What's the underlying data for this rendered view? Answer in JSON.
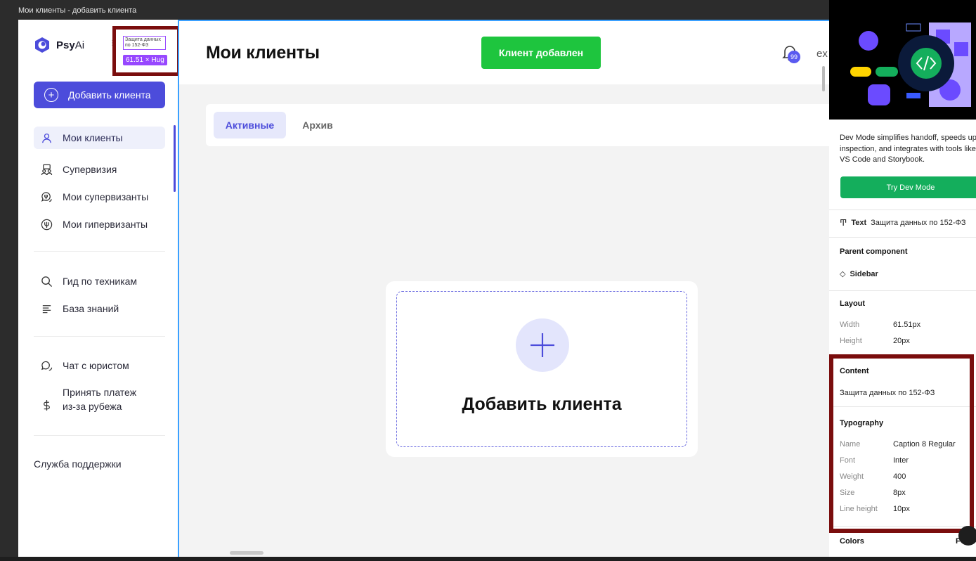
{
  "window": {
    "title": "Мои клиенты - добавить клиента"
  },
  "sidebar": {
    "logo_bold": "Psy",
    "logo_rest": "Ai",
    "selection_badge": {
      "text": "Защита данных по 152-ФЗ",
      "size_label": "61.51 × Hug"
    },
    "add_button_label": "Добавить клиента",
    "items": [
      {
        "label": "Мои клиенты",
        "icon": "user-icon",
        "active": true
      },
      {
        "label": "Супервизия",
        "icon": "group-icon"
      },
      {
        "label": "Мои супервизанты",
        "icon": "chat-psi-icon"
      },
      {
        "label": "Мои гипервизанты",
        "icon": "psi-icon"
      },
      {
        "label": "Гид по техникам",
        "icon": "search-icon"
      },
      {
        "label": "База знаний",
        "icon": "lines-icon"
      },
      {
        "label": "Чат с юристом",
        "icon": "chat-icon"
      },
      {
        "label": "Принять платеж\nиз-за рубежа",
        "icon": "dollar-icon"
      }
    ],
    "support_label": "Служба поддержки"
  },
  "header": {
    "title": "Мои клиенты",
    "toast": "Клиент добавлен",
    "notification_count": "99",
    "user_text": "ex"
  },
  "tabs": [
    {
      "label": "Активные",
      "active": true
    },
    {
      "label": "Архив",
      "active": false
    }
  ],
  "add_card": {
    "title": "Добавить клиента"
  },
  "panel": {
    "promo_text": "Dev Mode simplifies handoff, speeds up inspection, and integrates with tools like VS Code and Storybook.",
    "try_button": "Try Dev Mode",
    "selection_type": "Text",
    "selection_name": "Защита данных по 152-ФЗ",
    "parent_component_heading": "Parent component",
    "parent_component": "Sidebar",
    "layout": {
      "heading": "Layout",
      "width_label": "Width",
      "width_value": "61.51px",
      "height_label": "Height",
      "height_value": "20px"
    },
    "content": {
      "heading": "Content",
      "value": "Защита данных по 152-ФЗ"
    },
    "typography": {
      "heading": "Typography",
      "rows": [
        {
          "label": "Name",
          "value": "Caption 8 Regular"
        },
        {
          "label": "Font",
          "value": "Inter"
        },
        {
          "label": "Weight",
          "value": "400"
        },
        {
          "label": "Size",
          "value": "8px"
        },
        {
          "label": "Line height",
          "value": "10px"
        }
      ]
    },
    "colors_heading": "Colors",
    "colors_cut_text": "F"
  },
  "colors": {
    "accent": "#4c4cdb",
    "success": "#1ec53e",
    "figma_selection": "#9747ff",
    "highlight_frame": "#7a0d0d"
  }
}
